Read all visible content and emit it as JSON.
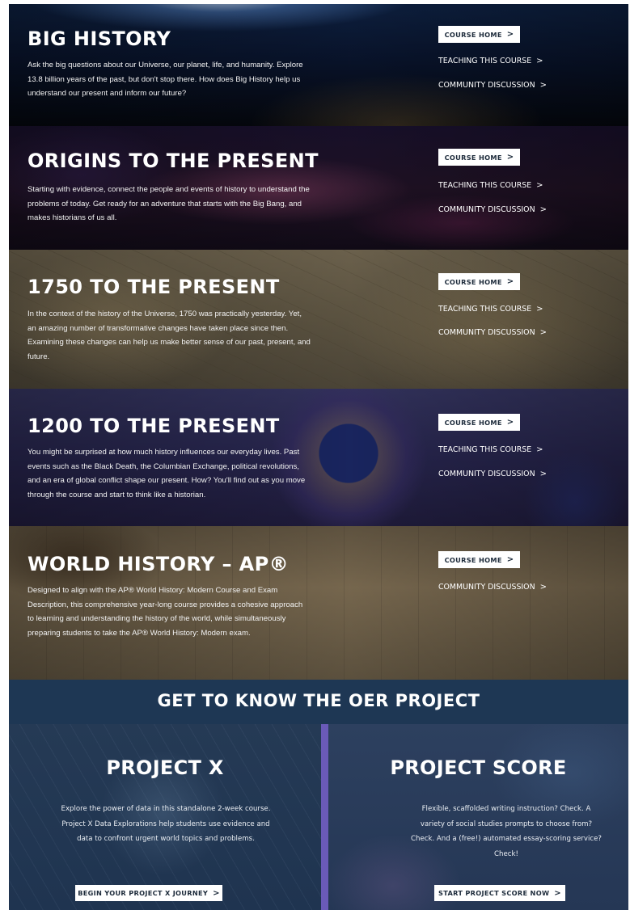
{
  "courses": [
    {
      "title": "BIG HISTORY",
      "description": "Ask the big questions about our Universe, our planet, life, and humanity. Explore 13.8 billion years of the past, but don't stop there. How does Big History help us understand our present and inform our future?",
      "course_home": "COURSE HOME",
      "teaching": "TEACHING THIS COURSE",
      "community": "COMMUNITY DISCUSSION"
    },
    {
      "title": "ORIGINS TO THE PRESENT",
      "description": "Starting with evidence, connect the people and events of history to understand the problems of today. Get ready for an adventure that starts with the Big Bang, and makes historians of us all.",
      "course_home": "COURSE HOME",
      "teaching": "TEACHING THIS COURSE",
      "community": "COMMUNITY DISCUSSION"
    },
    {
      "title": "1750 TO THE PRESENT",
      "description": "In the context of the history of the Universe, 1750 was practically yesterday. Yet, an amazing number of transformative changes have taken place since then. Examining these changes can help us make better sense of our past, present, and future.",
      "course_home": "COURSE HOME",
      "teaching": "TEACHING THIS COURSE",
      "community": "COMMUNITY DISCUSSION"
    },
    {
      "title": "1200 TO THE PRESENT",
      "description": "You might be surprised at how much history influences our everyday lives. Past events such as the Black Death, the Columbian Exchange, political revolutions, and an era of global conflict shape our present. How? You'll find out as you move through the course and start to think like a historian.",
      "course_home": "COURSE HOME",
      "teaching": "TEACHING THIS COURSE",
      "community": "COMMUNITY DISCUSSION"
    },
    {
      "title": "WORLD HISTORY – AP®",
      "description": "Designed to align with the AP® World History: Modern Course and Exam Description, this comprehensive year-long course provides a cohesive approach to learning and understanding the history of the world, while simultaneously preparing students to take the AP® World History: Modern exam.",
      "course_home": "COURSE HOME",
      "community": "COMMUNITY DISCUSSION"
    }
  ],
  "chevron": ">",
  "oer": {
    "heading": "GET TO KNOW THE OER PROJECT",
    "project_x": {
      "title": "PROJECT X",
      "description": "Explore the power of data in this standalone 2-week course. Project X Data Explorations help students use evidence and data to confront urgent world topics and problems.",
      "cta": "BEGIN YOUR PROJECT X JOURNEY"
    },
    "project_score": {
      "title": "PROJECT SCORE",
      "description": "Flexible, scaffolded writing instruction? Check. A variety of social studies prompts to choose from? Check. And a (free!) automated essay-scoring service? Check!",
      "cta": "START PROJECT SCORE NOW"
    },
    "divider_color": "#6a5ab8"
  }
}
